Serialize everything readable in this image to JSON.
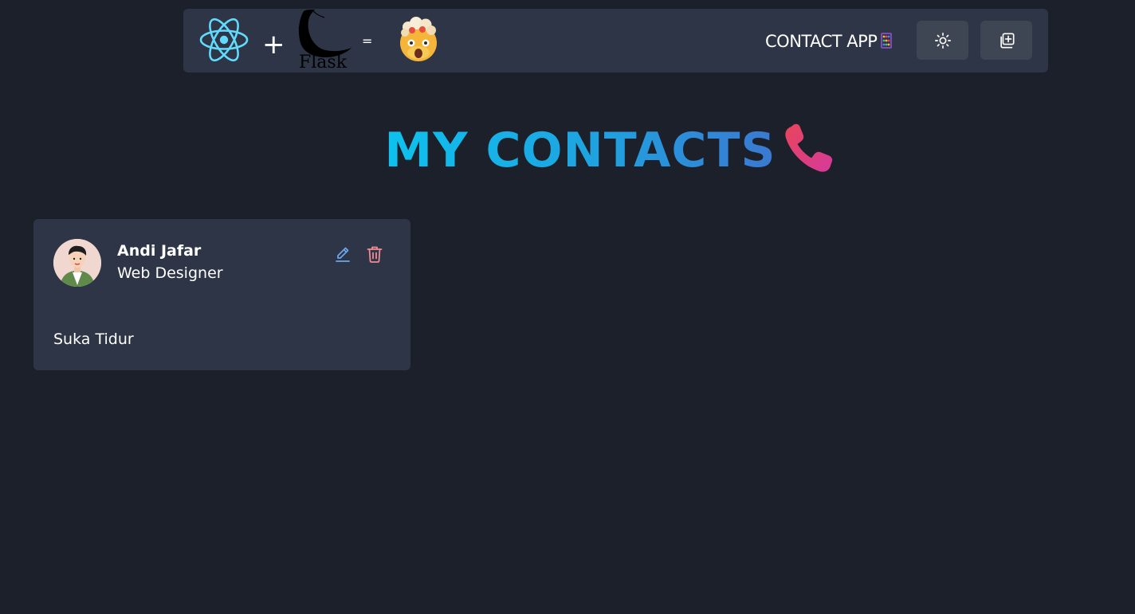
{
  "navbar": {
    "plus_sign": "+",
    "flask_label": "Flask",
    "equals_sign": "=",
    "app_title": "CONTACT APP",
    "icons": {
      "react": "react-logo-icon",
      "flask": "flask-logo-icon",
      "emoji": "exploding-head-emoji-icon",
      "abacus": "abacus-emoji-icon",
      "theme": "sun-icon",
      "add": "add-contact-icon"
    }
  },
  "page": {
    "heading": "MY CONTACTS",
    "heading_icon": "telephone-receiver-icon"
  },
  "contacts": [
    {
      "name": "Andi Jafar",
      "role": "Web Designer",
      "description": "Suka Tidur",
      "avatar_icon": "avatar-illustration",
      "edit_icon": "pencil-icon",
      "delete_icon": "trash-icon"
    }
  ],
  "colors": {
    "background": "#1b202b",
    "surface": "#2d3546",
    "button": "#3e4553",
    "edit": "#6aa6e8",
    "delete": "#f28b93",
    "heading_gradient_start": "#0ec2ee",
    "heading_gradient_end": "#3b78d0",
    "react": "#61dafb"
  }
}
